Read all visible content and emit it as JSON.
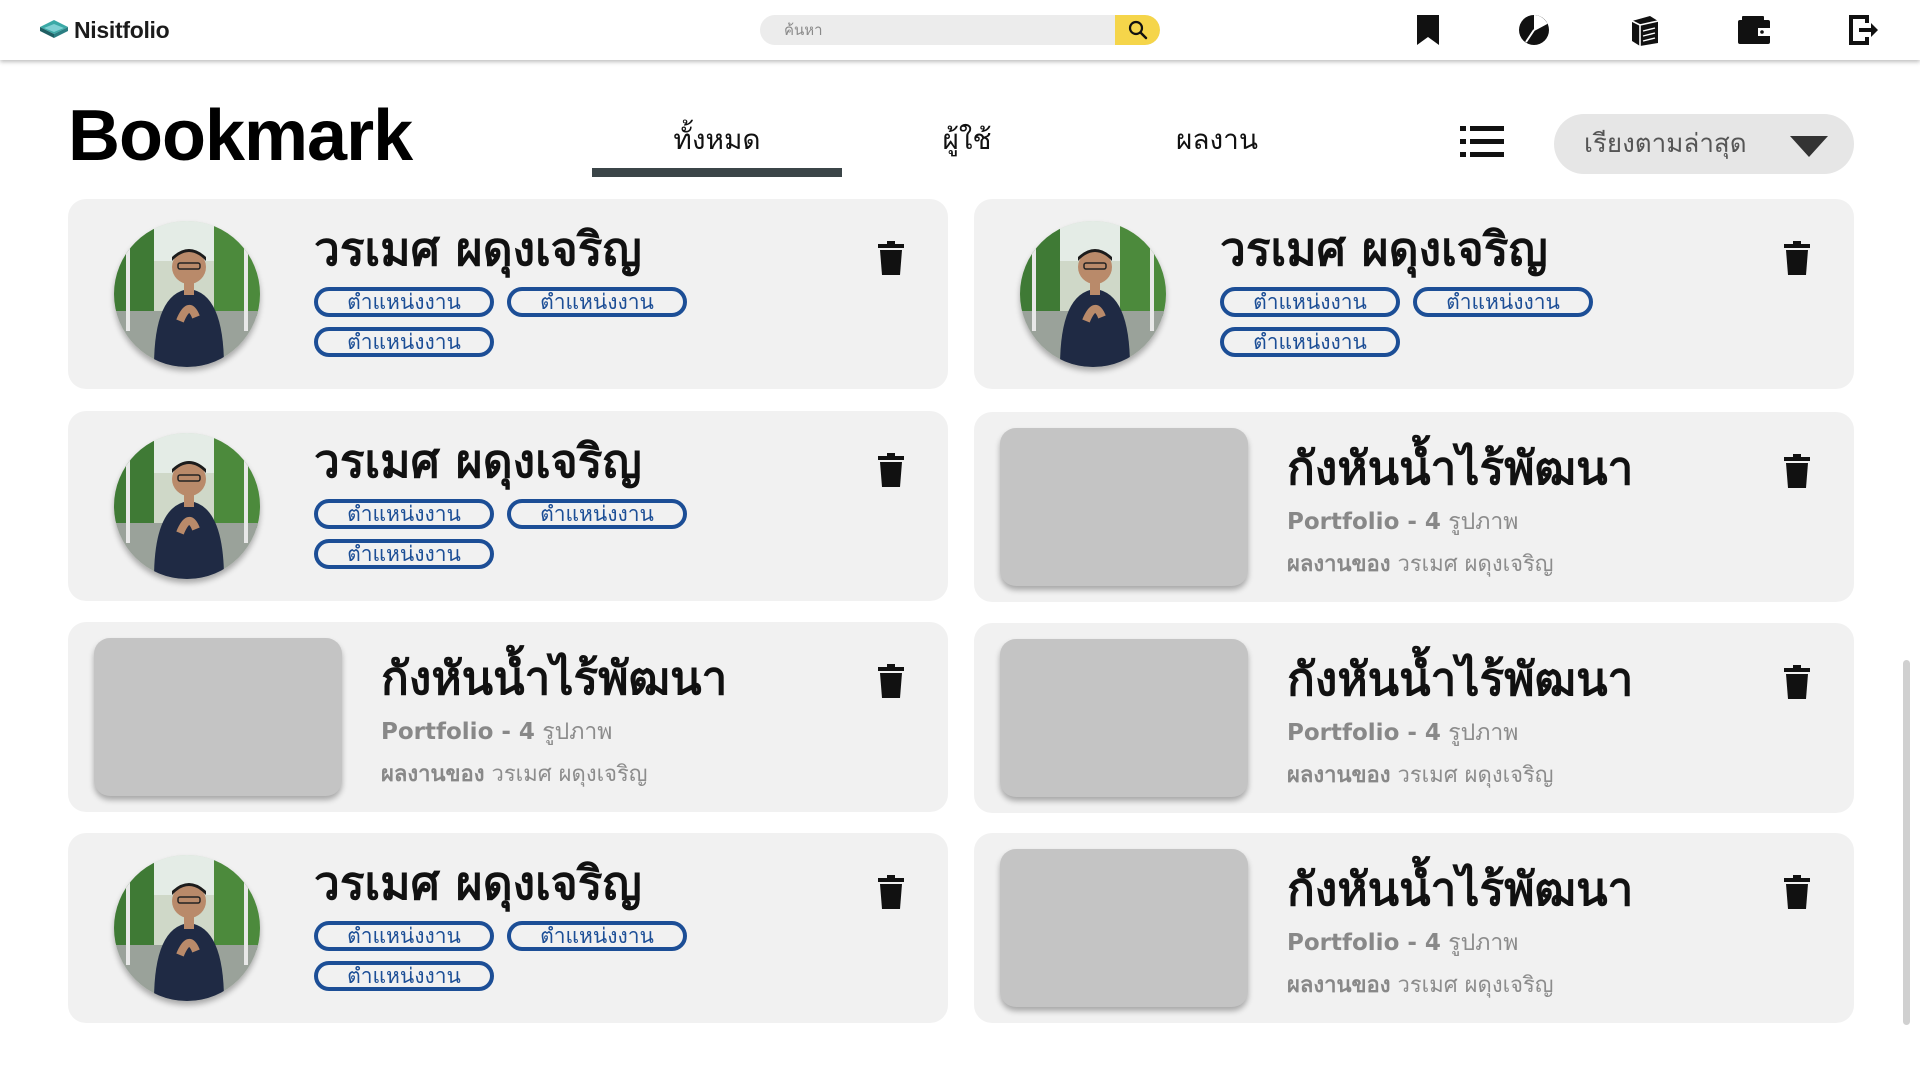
{
  "app": {
    "logo_text": "Nisitfolio"
  },
  "search": {
    "placeholder": "ค้นหา"
  },
  "nav": {
    "icons": [
      "bookmark-icon",
      "pie-chart-icon",
      "portfolio-icon",
      "wallet-icon",
      "logout-icon"
    ]
  },
  "page": {
    "title": "Bookmark"
  },
  "tabs": [
    {
      "label": "ทั้งหมด",
      "active": true
    },
    {
      "label": "ผู้ใช้",
      "active": false
    },
    {
      "label": "ผลงาน",
      "active": false
    }
  ],
  "sort": {
    "label": "เรียงตามล่าสุด"
  },
  "cards": {
    "c1": {
      "type": "user",
      "name": "วรเมศ ผดุงเจริญ",
      "tags": [
        "ตำแหน่งงาน",
        "ตำแหน่งงาน",
        "ตำแหน่งงาน"
      ]
    },
    "c2": {
      "type": "user",
      "name": "วรเมศ ผดุงเจริญ",
      "tags": [
        "ตำแหน่งงาน",
        "ตำแหน่งงาน",
        "ตำแหน่งงาน"
      ]
    },
    "c3": {
      "type": "user",
      "name": "วรเมศ ผดุงเจริญ",
      "tags": [
        "ตำแหน่งงาน",
        "ตำแหน่งงาน",
        "ตำแหน่งงาน"
      ]
    },
    "c4": {
      "type": "work",
      "title": "กังหันน้ำไร้พัฒนา",
      "meta_prefix": "Portfolio - 4",
      "meta_suffix": "รูปภาพ",
      "owner_label": "ผลงานของ",
      "owner": "วรเมศ ผดุงเจริญ"
    },
    "c5": {
      "type": "work",
      "title": "กังหันน้ำไร้พัฒนา",
      "meta_prefix": "Portfolio - 4",
      "meta_suffix": "รูปภาพ",
      "owner_label": "ผลงานของ",
      "owner": "วรเมศ ผดุงเจริญ"
    },
    "c6": {
      "type": "work",
      "title": "กังหันน้ำไร้พัฒนา",
      "meta_prefix": "Portfolio - 4",
      "meta_suffix": "รูปภาพ",
      "owner_label": "ผลงานของ",
      "owner": "วรเมศ ผดุงเจริญ"
    },
    "c7": {
      "type": "user",
      "name": "วรเมศ ผดุงเจริญ",
      "tags": [
        "ตำแหน่งงาน",
        "ตำแหน่งงาน",
        "ตำแหน่งงาน"
      ]
    },
    "c8": {
      "type": "work",
      "title": "กังหันน้ำไร้พัฒนา",
      "meta_prefix": "Portfolio - 4",
      "meta_suffix": "รูปภาพ",
      "owner_label": "ผลงานของ",
      "owner": "วรเมศ ผดุงเจริญ"
    }
  },
  "colors": {
    "accent_yellow": "#f5d54a",
    "tag_blue": "#1c4e96",
    "tab_underline": "#3b4548",
    "card_bg": "#f1f1f1"
  }
}
